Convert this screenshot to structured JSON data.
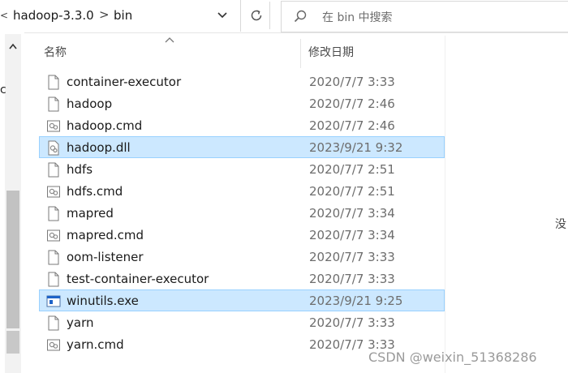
{
  "address_bar": {
    "lead_glyph": "<",
    "crumbs": [
      "hadoop-3.3.0",
      "bin"
    ],
    "separator": ">"
  },
  "search": {
    "placeholder": "在 bin 中搜索"
  },
  "nav": {
    "glyph": "c"
  },
  "columns": {
    "name": "名称",
    "date_modified": "修改日期"
  },
  "files": [
    {
      "name": "container-executor",
      "date": "2020/7/7 3:33",
      "icon": "file-icon",
      "selected": false
    },
    {
      "name": "hadoop",
      "date": "2020/7/7 2:46",
      "icon": "file-icon",
      "selected": false
    },
    {
      "name": "hadoop.cmd",
      "date": "2020/7/7 2:46",
      "icon": "cmd-file-icon",
      "selected": false
    },
    {
      "name": "hadoop.dll",
      "date": "2023/9/21 9:32",
      "icon": "dll-file-icon",
      "selected": true
    },
    {
      "name": "hdfs",
      "date": "2020/7/7 2:51",
      "icon": "file-icon",
      "selected": false
    },
    {
      "name": "hdfs.cmd",
      "date": "2020/7/7 2:51",
      "icon": "cmd-file-icon",
      "selected": false
    },
    {
      "name": "mapred",
      "date": "2020/7/7 3:34",
      "icon": "file-icon",
      "selected": false
    },
    {
      "name": "mapred.cmd",
      "date": "2020/7/7 3:34",
      "icon": "cmd-file-icon",
      "selected": false
    },
    {
      "name": "oom-listener",
      "date": "2020/7/7 3:33",
      "icon": "file-icon",
      "selected": false
    },
    {
      "name": "test-container-executor",
      "date": "2020/7/7 3:33",
      "icon": "file-icon",
      "selected": false
    },
    {
      "name": "winutils.exe",
      "date": "2023/9/21 9:25",
      "icon": "exe-file-icon",
      "selected": true
    },
    {
      "name": "yarn",
      "date": "2020/7/7 3:33",
      "icon": "file-icon",
      "selected": false
    },
    {
      "name": "yarn.cmd",
      "date": "2020/7/7 3:33",
      "icon": "cmd-file-icon",
      "selected": false
    }
  ],
  "side_glyph": "没",
  "watermark": "CSDN @weixin_51368286",
  "colors": {
    "selection": "#cce8ff",
    "selection_border": "#99d1ff",
    "exe_blue": "#1e63c8"
  }
}
